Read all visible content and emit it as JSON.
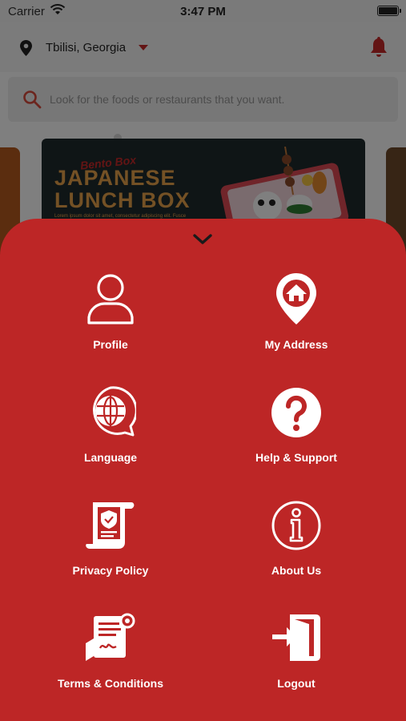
{
  "status_bar": {
    "carrier": "Carrier",
    "time": "3:47 PM"
  },
  "location": {
    "city": "Tbilisi, Georgia"
  },
  "search": {
    "placeholder": "Look for the foods or restaurants that you want."
  },
  "banner": {
    "subtitle": "Bento Box",
    "title_line1": "JAPANESE",
    "title_line2": "LUNCH BOX",
    "caption": "Lorem ipsum dolor sit amet, consectetur adipiscing elit. Fusce"
  },
  "menu": {
    "items": [
      {
        "label": "Profile",
        "icon": "profile-icon"
      },
      {
        "label": "My Address",
        "icon": "home-pin-icon"
      },
      {
        "label": "Language",
        "icon": "globe-chat-icon"
      },
      {
        "label": "Help & Support",
        "icon": "question-icon"
      },
      {
        "label": "Privacy Policy",
        "icon": "document-shield-icon"
      },
      {
        "label": "About Us",
        "icon": "info-icon"
      },
      {
        "label": "Terms & Conditions",
        "icon": "contract-sign-icon"
      },
      {
        "label": "Logout",
        "icon": "logout-icon"
      }
    ]
  },
  "colors": {
    "accent": "#bd2626",
    "banner_text": "#e8a24a",
    "banner_bg": "#1f2b2d"
  }
}
